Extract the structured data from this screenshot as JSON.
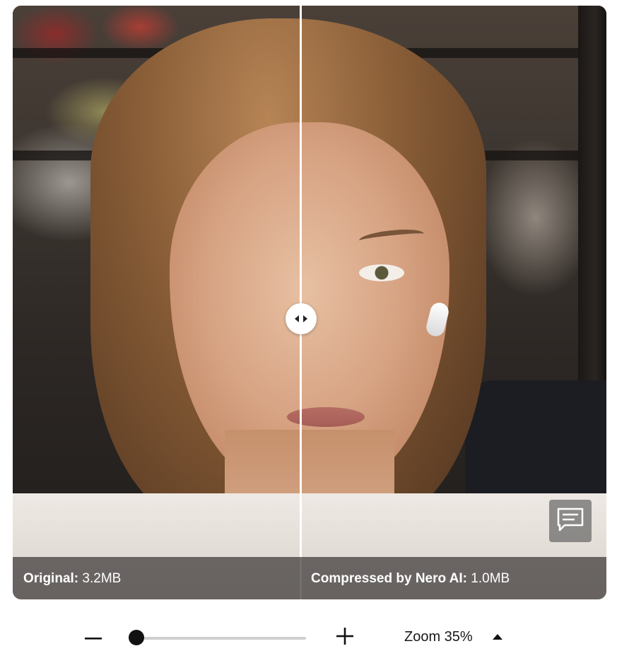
{
  "comparison": {
    "left_label_bold": "Original:",
    "left_label_value": " 3.2MB",
    "right_label_bold": "Compressed by Nero AI:",
    "right_label_value": " 1.0MB",
    "divider_handle_icon": "left-right-arrows-icon",
    "chat_button_icon": "chat-bubble-icon"
  },
  "zoom": {
    "minus_icon": "minus-icon",
    "plus_icon": "plus-icon",
    "slider_level": 0.03,
    "label": "Zoom 35%",
    "caret_icon": "caret-up-icon"
  }
}
